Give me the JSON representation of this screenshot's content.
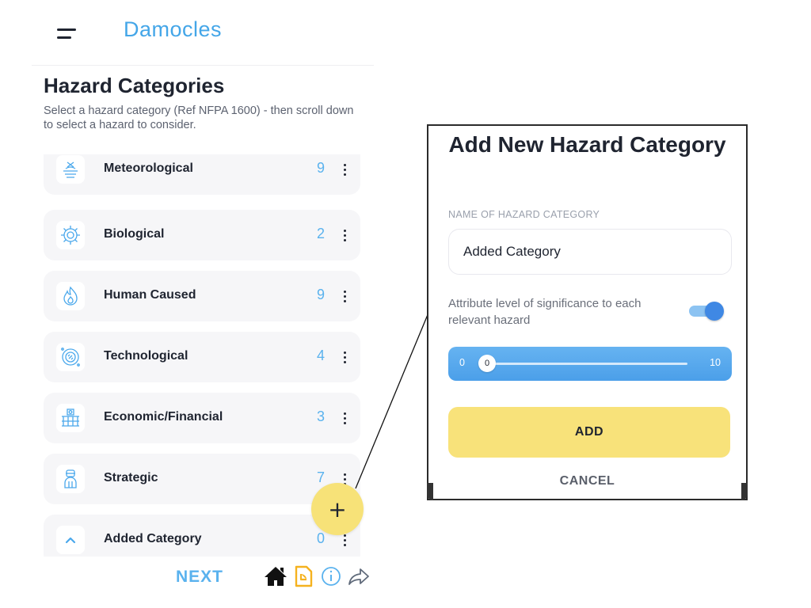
{
  "header": {
    "app_title": "Damocles",
    "icon": "hamburger-menu-icon"
  },
  "page": {
    "title": "Hazard Categories",
    "subtitle": "Select a hazard category (Ref NFPA 1600) - then scroll down to select a hazard to consider."
  },
  "categories": [
    {
      "label": "Meteorological",
      "count": "9",
      "icon": "meteorological-icon"
    },
    {
      "label": "Biological",
      "count": "2",
      "icon": "biological-icon"
    },
    {
      "label": "Human Caused",
      "count": "9",
      "icon": "human-caused-icon"
    },
    {
      "label": "Technological",
      "count": "4",
      "icon": "technological-icon"
    },
    {
      "label": "Economic/Financial",
      "count": "3",
      "icon": "economic-financial-icon"
    },
    {
      "label": "Strategic",
      "count": "7",
      "icon": "strategic-icon"
    },
    {
      "label": "Added Category",
      "count": "0",
      "icon": "chevron-up-icon"
    }
  ],
  "fab": {
    "label": "+"
  },
  "bottom_nav": {
    "next_label": "NEXT",
    "icons": [
      "home-icon",
      "report-icon",
      "info-icon",
      "share-icon"
    ]
  },
  "dialog": {
    "title": "Add New Hazard Category",
    "field_caption": "NAME OF HAZARD CATEGORY",
    "name_value": "Added Category",
    "toggle_label": "Attribute level of significance to each relevant hazard",
    "toggle_on": true,
    "slider": {
      "min": "0",
      "max": "10",
      "value": "0"
    },
    "add_label": "ADD",
    "cancel_label": "CANCEL"
  },
  "colors": {
    "accent_blue": "#44a6e8",
    "count_blue": "#5ab2ee",
    "fab_yellow": "#f7e278",
    "card_bg": "#f6f6f8",
    "toggle_blue": "#3f88e4"
  }
}
